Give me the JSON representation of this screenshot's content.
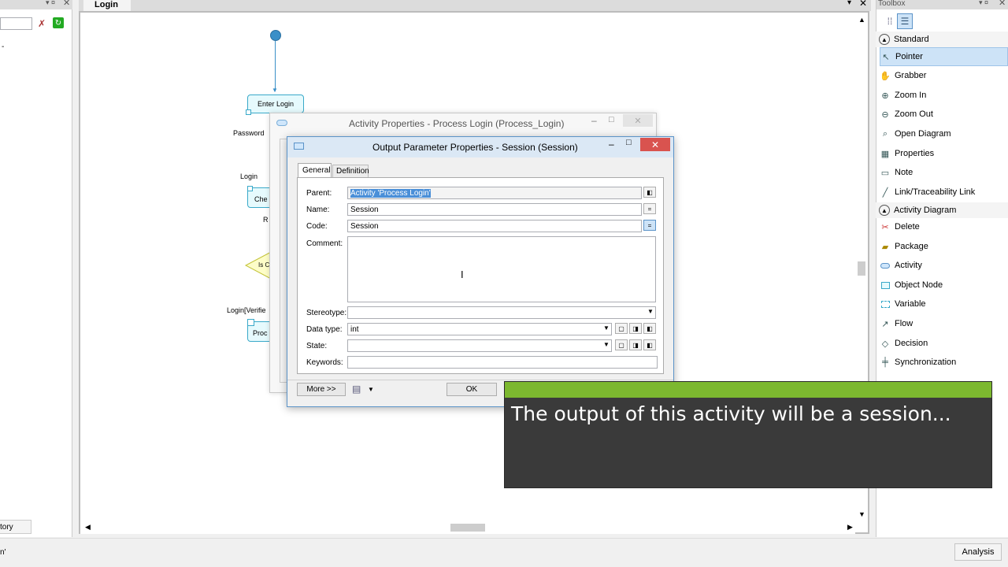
{
  "diagram_tab": {
    "title": "Login"
  },
  "left_panel": {
    "bottom_tab": "tory",
    "status_text": "n'"
  },
  "diagram": {
    "nodes": {
      "enter_login": "Enter Login",
      "check": "Che",
      "is_check": "Is C",
      "process": "Proc"
    },
    "labels": {
      "password": "Password",
      "login": "Login",
      "r": "R",
      "login_verified": "Login[Verifie"
    }
  },
  "activity_dialog": {
    "title": "Activity Properties - Process Login (Process_Login)"
  },
  "output_dialog": {
    "title": "Output Parameter Properties - Session (Session)",
    "tabs": [
      {
        "label": "General"
      },
      {
        "label": "Definition"
      }
    ],
    "fields": {
      "parent": {
        "label": "Parent:",
        "value": "Activity 'Process Login'"
      },
      "name": {
        "label": "Name:",
        "value": "Session"
      },
      "code": {
        "label": "Code:",
        "value": "Session"
      },
      "comment": {
        "label": "Comment:",
        "value": ""
      },
      "stereotype": {
        "label": "Stereotype:",
        "value": ""
      },
      "data_type": {
        "label": "Data type:",
        "value": "int"
      },
      "state": {
        "label": "State:",
        "value": ""
      },
      "keywords": {
        "label": "Keywords:",
        "value": ""
      }
    },
    "eq_label": "=",
    "buttons": {
      "more": "More >>",
      "ok": "OK"
    }
  },
  "toolbox": {
    "title": "Toolbox",
    "sections": [
      {
        "label": "Standard",
        "items": [
          "Pointer",
          "Grabber",
          "Zoom In",
          "Zoom Out",
          "Open Diagram",
          "Properties",
          "Note",
          "Link/Traceability Link"
        ]
      },
      {
        "label": "Activity Diagram",
        "items": [
          "Delete",
          "Package",
          "Activity",
          "Object Node",
          "Variable",
          "Flow",
          "Decision",
          "Synchronization"
        ]
      }
    ]
  },
  "caption": {
    "text": "The output of this activity will be a session..."
  },
  "statusbar": {
    "analysis": "Analysis"
  },
  "colors": {
    "caption_green": "#7cb82f",
    "caption_bg": "#3a3a3a",
    "selection": "#cde3f7",
    "close_red": "#d9534f"
  }
}
